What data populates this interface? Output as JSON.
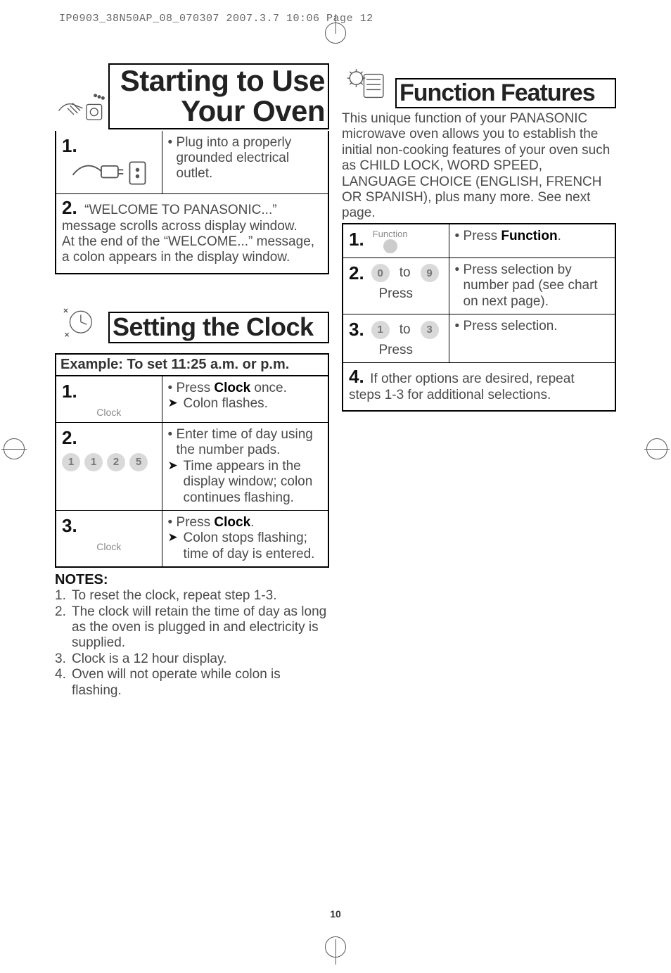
{
  "header_slug": "IP0903_38N50AP_08_070307  2007.3.7  10:06  Page 12",
  "page_word": "Page 12",
  "page_number": "10",
  "starting": {
    "title_line1": "Starting to Use",
    "title_line2": "Your Oven",
    "step1": {
      "num": "1.",
      "text": "Plug into a properly grounded electrical outlet."
    },
    "step2": {
      "num": "2.",
      "text": "“WELCOME TO PANASONIC...” message scrolls across display window.\nAt the end of the “WELCOME...” message, a colon appears in the display window."
    }
  },
  "clock": {
    "title": "Setting the Clock",
    "example": "Example: To set 11:25 a.m. or p.m.",
    "step1": {
      "num": "1.",
      "key_label": "Clock",
      "bullet": "Press ",
      "bullet_bold": "Clock",
      "bullet_after": " once.",
      "arrow": "Colon flashes."
    },
    "step2": {
      "num": "2.",
      "keys": [
        "1",
        "1",
        "2",
        "5"
      ],
      "bullet": "Enter time of day using the number pads.",
      "arrow": "Time appears in the display window; colon continues flashing."
    },
    "step3": {
      "num": "3.",
      "key_label": "Clock",
      "bullet": "Press ",
      "bullet_bold": "Clock",
      "bullet_after": ".",
      "arrow": "Colon stops flash­ing; time of day is entered."
    },
    "notes_head": "NOTES:",
    "notes": [
      {
        "n": "1.",
        "t": "To reset the clock, repeat step 1-3."
      },
      {
        "n": "2.",
        "t": "The clock will retain the time of day as long as the oven is plugged in and electricity is supplied."
      },
      {
        "n": "3.",
        "t": "Clock is a 12 hour display."
      },
      {
        "n": "4.",
        "t": "Oven will not operate while colon is flashing."
      }
    ]
  },
  "func": {
    "title": "Function Features",
    "intro": "This unique function of your PANASONIC microwave oven allows you to establish the initial non-cooking features of your oven such as CHILD LOCK, WORD SPEED, LANGUAGE CHOICE (ENG­LISH, FRENCH OR SPANISH), plus many more. See next page.",
    "step1": {
      "num": "1.",
      "key_label": "Function",
      "bullet": "Press ",
      "bullet_bold": "Function",
      "bullet_after": "."
    },
    "step2": {
      "num": "2.",
      "key_from": "0",
      "to": "to",
      "key_to": "9",
      "press": "Press",
      "bullet": "Press selection by number pad (see chart on next page)."
    },
    "step3": {
      "num": "3.",
      "key_from": "1",
      "to": "to",
      "key_to": "3",
      "press": "Press",
      "bullet": "Press selection."
    },
    "step4": {
      "num": "4.",
      "text": "If other options are desired, repeat steps 1-3 for additional selections."
    }
  }
}
